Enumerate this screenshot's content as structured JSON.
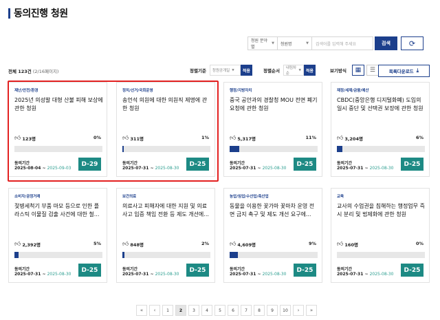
{
  "page": {
    "title": "동의진행 청원"
  },
  "search": {
    "field_label": "청원 분야별",
    "field2_label": "청원명",
    "input_placeholder": "검색어를 입력해 주세요",
    "search_button": "검색",
    "refresh_icon": "refresh-icon"
  },
  "summary": {
    "total": "전체 123건",
    "pages": "(2/16페이지)"
  },
  "sort": {
    "label": "정렬기준",
    "value": "청원공개일",
    "apply": "적용",
    "order_label": "정렬순서",
    "order_value": "내림차순",
    "order_apply": "적용",
    "view_label": "보기방식",
    "download": "목록다운로드"
  },
  "cards": [
    {
      "category": "재난/안전/환경",
      "title": "2025년 의성발 대형 산불 피해 보상에 관한 청원",
      "votes": "123명",
      "percent": "0%",
      "progress": 0,
      "period_label": "동의기간",
      "start": "2025-08-04 ~",
      "end": "2025-09-03",
      "dday": "D-29"
    },
    {
      "category": "정치/선거/국회운영",
      "title": "송언석 의원에 대한 의원직 제명에 관한 청원",
      "votes": "311명",
      "percent": "1%",
      "progress": 1,
      "period_label": "동의기간",
      "start": "2025-07-31 ~",
      "end": "2025-08-30",
      "dday": "D-25"
    },
    {
      "category": "행정/지방자치",
      "title": "중국 공안과의 경찰청 MOU 전면 폐기 요청에 관한 청원",
      "votes": "5,317명",
      "percent": "11%",
      "progress": 11,
      "period_label": "동의기간",
      "start": "2025-07-31 ~",
      "end": "2025-08-30",
      "dday": "D-25"
    },
    {
      "category": "재정/세제/금융/예산",
      "title": "CBDC(중앙은행 디지털화폐) 도입의 일시 중단 및 선택권 보장에 관한 청원",
      "votes": "3,204명",
      "percent": "6%",
      "progress": 6,
      "period_label": "동의기간",
      "start": "2025-07-31 ~",
      "end": "2025-08-30",
      "dday": "D-25"
    },
    {
      "category": "소비자/공정거래",
      "title": "젖병세척기 부품 마모 등으로 인한 플라스틱 이물질 검출 사건에 대한 철...",
      "votes": "2,392명",
      "percent": "5%",
      "progress": 5,
      "period_label": "동의기간",
      "start": "2025-07-31 ~",
      "end": "2025-08-30",
      "dday": "D-25"
    },
    {
      "category": "보건의료",
      "title": "의료사고 피해자에 대한 지원 및 의료사고 입증 책임 전환 등 제도 개선에...",
      "votes": "848명",
      "percent": "2%",
      "progress": 2,
      "period_label": "동의기간",
      "start": "2025-07-31 ~",
      "end": "2025-08-30",
      "dday": "D-25"
    },
    {
      "category": "농업/임업/수산업/축산업",
      "title": "동물을 이용한 꽃가마 꽃마차 운영 전면 금지 촉구 및 제도 개선 요구에...",
      "votes": "4,609명",
      "percent": "9%",
      "progress": 9,
      "period_label": "동의기간",
      "start": "2025-07-31 ~",
      "end": "2025-08-30",
      "dday": "D-25"
    },
    {
      "category": "교육",
      "title": "교사의 수업권을 침해하는 행정업무 즉시 분리 및 법제화에 관한 청원",
      "votes": "160명",
      "percent": "0%",
      "progress": 0,
      "period_label": "동의기간",
      "start": "2025-07-31 ~",
      "end": "2025-08-30",
      "dday": "D-25"
    }
  ],
  "pager": {
    "first": "«",
    "prev": "‹",
    "pages": [
      "1",
      "2",
      "3",
      "4",
      "5",
      "6",
      "7",
      "8",
      "9",
      "10"
    ],
    "current": "2",
    "next": "›",
    "last": "»"
  },
  "colors": {
    "brand": "#1c3f8c",
    "dday": "#1d8a84",
    "highlight": "#e32020"
  }
}
